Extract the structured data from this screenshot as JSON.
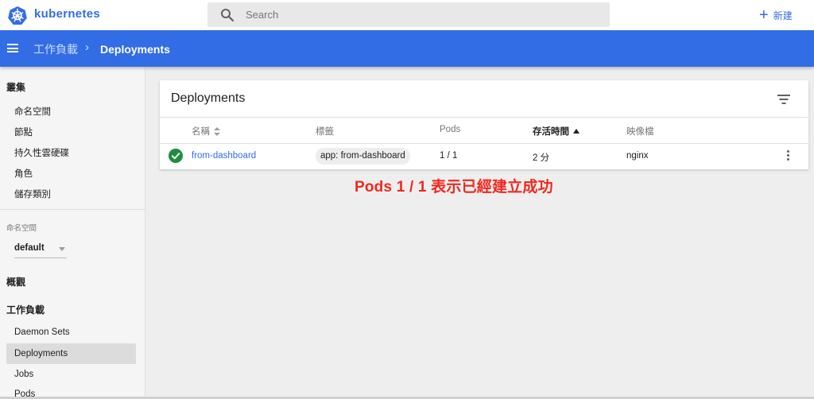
{
  "header": {
    "brand": "kubernetes",
    "search_placeholder": "Search",
    "create_label": "新建"
  },
  "toolbar": {
    "breadcrumb_parent": "工作負載",
    "breadcrumb_separator": "›",
    "breadcrumb_current": "Deployments"
  },
  "sidebar": {
    "cluster_heading": "叢集",
    "cluster_items": [
      "命名空間",
      "節點",
      "持久性雲硬碟",
      "角色",
      "儲存類別"
    ],
    "namespace_label": "命名空間",
    "namespace_value": "default",
    "overview_heading": "概觀",
    "workloads_heading": "工作負載",
    "workload_items": [
      "Daemon Sets",
      "Deployments",
      "Jobs",
      "Pods"
    ],
    "active_item": "Deployments"
  },
  "card": {
    "title": "Deployments",
    "columns": [
      "名稱",
      "標籤",
      "Pods",
      "存活時間",
      "映像檔"
    ],
    "rows": [
      {
        "status": "success",
        "name": "from-dashboard",
        "label": "app: from-dashboard",
        "pods": "1 / 1",
        "age": "2 分",
        "image": "nginx"
      }
    ]
  },
  "annotation": "Pods 1 / 1 表示已經建立成功",
  "colors": {
    "brand_blue": "#326de6",
    "success_green": "#1e8e3e",
    "annotation_red": "#f0281e"
  }
}
